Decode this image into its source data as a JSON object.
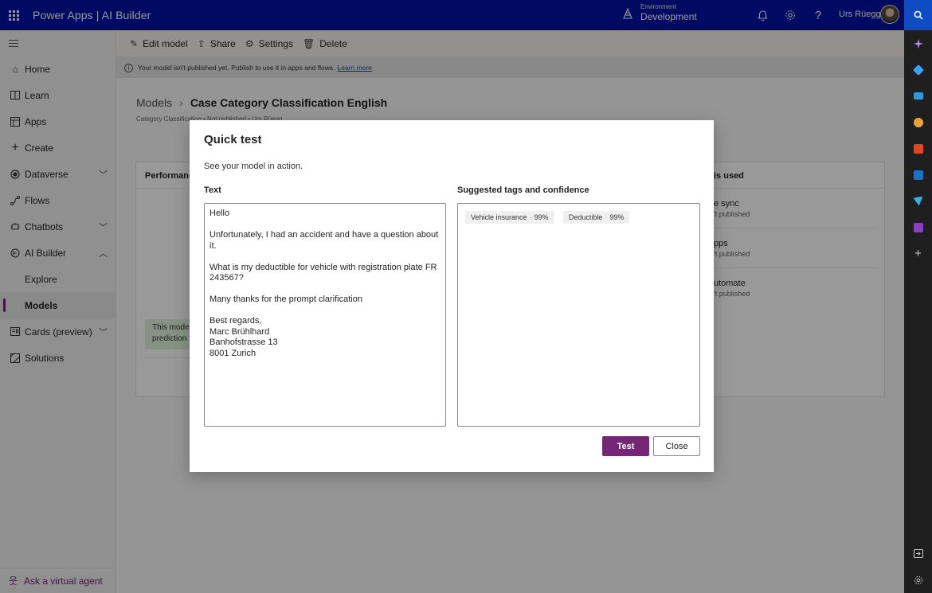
{
  "header": {
    "app_title": "Power Apps  |  AI Builder",
    "environment_label": "Environment",
    "environment_name": "Development",
    "user_name": "Urs Rüegg",
    "brand_color": "#0012a4"
  },
  "command_bar": {
    "edit_model": "Edit model",
    "share": "Share",
    "settings": "Settings",
    "delete": "Delete"
  },
  "info_bar": {
    "message": "Your model isn't published yet. Publish to use it in apps and flows.",
    "link": "Learn more"
  },
  "left_nav": {
    "items": [
      {
        "label": "Home",
        "icon": "home-icon"
      },
      {
        "label": "Learn",
        "icon": "book-icon"
      },
      {
        "label": "Apps",
        "icon": "apps-icon"
      },
      {
        "label": "Create",
        "icon": "plus-icon"
      },
      {
        "label": "Dataverse",
        "icon": "dataverse-icon"
      },
      {
        "label": "Flows",
        "icon": "flows-icon"
      },
      {
        "label": "Chatbots",
        "icon": "chatbot-icon"
      },
      {
        "label": "AI Builder",
        "icon": "ai-builder-icon"
      },
      {
        "label": "Explore"
      },
      {
        "label": "Models"
      },
      {
        "label": "Cards (preview)",
        "icon": "cards-icon"
      },
      {
        "label": "Solutions",
        "icon": "solutions-icon"
      }
    ],
    "footer": "Ask a virtual agent",
    "accent_color": "#742774"
  },
  "page": {
    "breadcrumb_root": "Models",
    "breadcrumb_title": "Case Category Classification English",
    "subline": "Category Classification • Not published • Urs Rüegg",
    "performance_title": "Performance",
    "used_title": "is used",
    "used_items": [
      {
        "title": "e sync",
        "status": "'t published"
      },
      {
        "title": "pps",
        "status": "'t published"
      },
      {
        "title": "utomate",
        "status": "'t published"
      }
    ],
    "green_note": "This model\nprediction"
  },
  "dialog": {
    "title": "Quick test",
    "subtitle": "See your model in action.",
    "text_label": "Text",
    "text_value": "Hello\n\nUnfortunately, I had an accident and have a question about it.\n\nWhat is my deductible for vehicle with registration plate FR 243567?\n\nMany thanks for the prompt clarification\n\nBest regards,\nMarc Brühlhard\nBanhofstrasse 13\n8001 Zurich",
    "tags_label": "Suggested tags and confidence",
    "tags": [
      {
        "name": "Vehicle insurance",
        "confidence": "99%"
      },
      {
        "name": "Deductible",
        "confidence": "99%"
      }
    ],
    "test_button": "Test",
    "close_button": "Close"
  }
}
